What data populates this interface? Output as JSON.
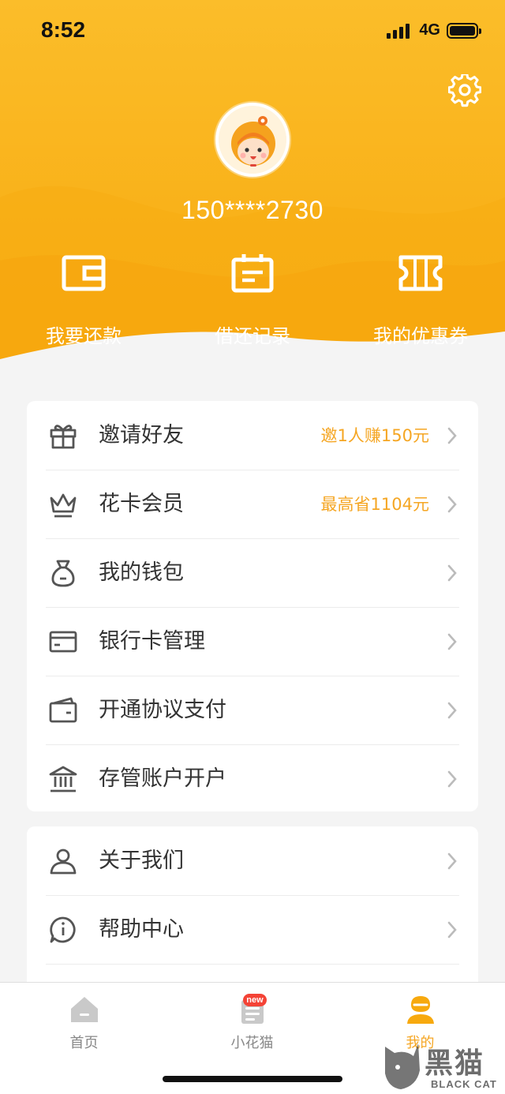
{
  "status_bar": {
    "time": "8:52",
    "network": "4G"
  },
  "header": {
    "phone": "150****2730",
    "settings_icon": "gear-icon",
    "avatar_icon": "cartoon-girl-avatar",
    "quick_actions": [
      {
        "label": "我要还款",
        "icon": "wallet-icon"
      },
      {
        "label": "借还记录",
        "icon": "calendar-record-icon"
      },
      {
        "label": "我的优惠券",
        "icon": "ticket-icon"
      }
    ]
  },
  "menu_group_1": [
    {
      "label": "邀请好友",
      "extra": "邀1人赚150元",
      "icon": "gift-icon"
    },
    {
      "label": "花卡会员",
      "extra": "最高省1104元",
      "icon": "crown-icon"
    },
    {
      "label": "我的钱包",
      "extra": "",
      "icon": "money-bag-icon"
    },
    {
      "label": "银行卡管理",
      "extra": "",
      "icon": "bank-card-icon"
    },
    {
      "label": "开通协议支付",
      "extra": "",
      "icon": "card-wallet-icon"
    },
    {
      "label": "存管账户开户",
      "extra": "",
      "icon": "bank-building-icon"
    }
  ],
  "menu_group_2": [
    {
      "label": "关于我们",
      "icon": "user-icon"
    },
    {
      "label": "帮助中心",
      "icon": "info-chat-icon"
    }
  ],
  "tabbar": {
    "tabs": [
      {
        "label": "首页",
        "icon": "home-icon"
      },
      {
        "label": "小花猫",
        "icon": "mascot-book-icon",
        "badge": "new"
      },
      {
        "label": "我的",
        "icon": "profile-icon",
        "active": true
      }
    ]
  },
  "watermark": {
    "title": "黑猫",
    "subtitle": "BLACK CAT"
  },
  "colors": {
    "brand": "#f9b21a",
    "accent_text": "#f5a623",
    "badge": "#f44336"
  }
}
